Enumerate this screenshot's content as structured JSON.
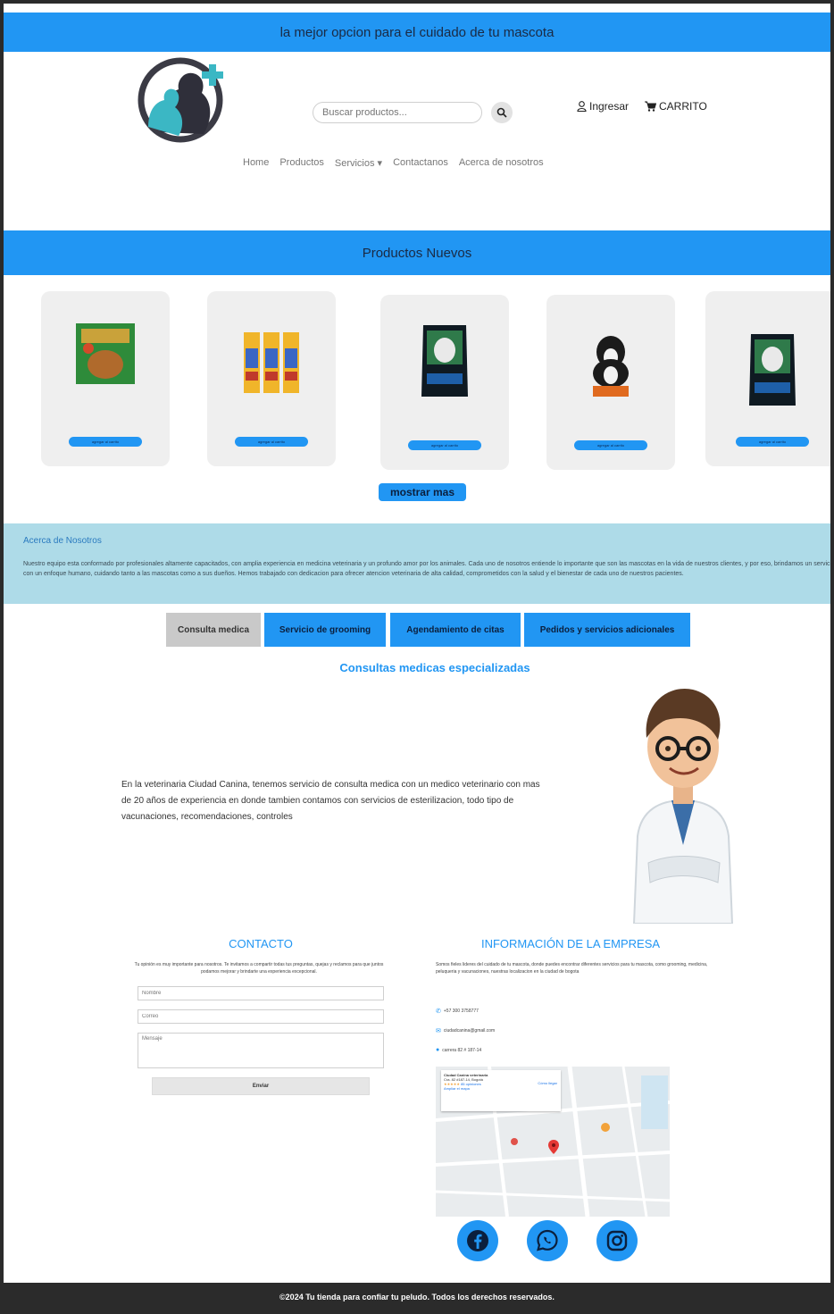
{
  "top_banner": {
    "text": "la mejor opcion para el cuidado de tu mascota"
  },
  "header": {
    "search_placeholder": "Buscar productos...",
    "login_label": "Ingresar",
    "cart_label": "CARRITO"
  },
  "nav": {
    "items": [
      "Home",
      "Productos",
      "Servicios ▾",
      "Contactanos",
      "Acerca de nosotros"
    ]
  },
  "new_products": {
    "title": "Productos Nuevos",
    "products": [
      {
        "image": "dog-treats-box",
        "button": "agregar al carrito"
      },
      {
        "image": "cat-treat-sticks",
        "button": "agregar al carrito"
      },
      {
        "image": "dog-food-bag-dark",
        "button": "agregar al carrito"
      },
      {
        "image": "dog-food-bag-bernese",
        "button": "agregar al carrito"
      },
      {
        "image": "dog-food-bag-dark",
        "button": "agregar al carrito"
      }
    ],
    "more_button": "mostrar mas"
  },
  "about": {
    "title": "Acerca de Nosotros",
    "text": "Nuestro equipo esta conformado por profesionales altamente capacitados, con amplia experiencia en medicina veterinaria y un profundo amor por los animales. Cada uno de nosotros entiende lo importante que son las mascotas en la vida de nuestros clientes, y por eso, brindamos un servicio integral, personalizado y con un enfoque humano, cuidando tanto a las mascotas como a sus dueños. Hemos trabajado con dedicacion para ofrecer atencion veterinaria de alta calidad, comprometidos con la salud y el bienestar de cada uno de nuestros pacientes."
  },
  "service_tabs": {
    "tabs": [
      "Consulta medica",
      "Servicio de grooming",
      "Agendamiento de citas",
      "Pedidos y servicios adicionales"
    ],
    "active_index": 0,
    "section_title": "Consultas medicas especializadas",
    "description": "En la veterinaria Ciudad Canina, tenemos servicio de consulta medica con un medico veterinario con mas de 20 años de experiencia en donde tambien contamos con servicios de esterilizacion, todo tipo de vacunaciones, recomendaciones, controles"
  },
  "contact": {
    "title": "CONTACTO",
    "description": "Tu opinión es muy importante para nosotros. Te invitamos a compartir todas tus preguntas, quejas y reclamos para que juntos podamos mejorar y brindarte una experiencia excepcional.",
    "name_placeholder": "Nombre",
    "email_placeholder": "Correo",
    "message_placeholder": "Mensaje",
    "send_button": "Enviar"
  },
  "company_info": {
    "title": "INFORMACIÓN DE LA EMPRESA",
    "description": "Somos fieles lideres del cuidado de tu mascota, donde puedes encontrar diferentes servicios para tu mascota, como grooming, medicina, peluqueria y vacunaciones, nuestras localizacion en la ciudad de bogota",
    "phone": "+57 300 3758777",
    "email": "ciudadcanina@gmail.com",
    "address": "carrera 82 # 187-14",
    "map": {
      "place_name": "Ciudad Canina veterinaria",
      "address_line": "Cra. 82 #187-14, Bogotá",
      "rating": "★★★★★",
      "reviews": "85 opiniones",
      "directions": "Cómo llegar",
      "bigger_map": "Ampliar el mapa"
    }
  },
  "social": [
    "facebook-icon",
    "whatsapp-icon",
    "instagram-icon"
  ],
  "footer": {
    "text": "©2024 Tu tienda para confiar tu peludo. Todos los derechos reservados."
  },
  "colors": {
    "primary": "#2196f3",
    "about_bg": "#aedbe8",
    "footer_bg": "#2b2b2b",
    "tab_active": "#c9c9c9"
  }
}
